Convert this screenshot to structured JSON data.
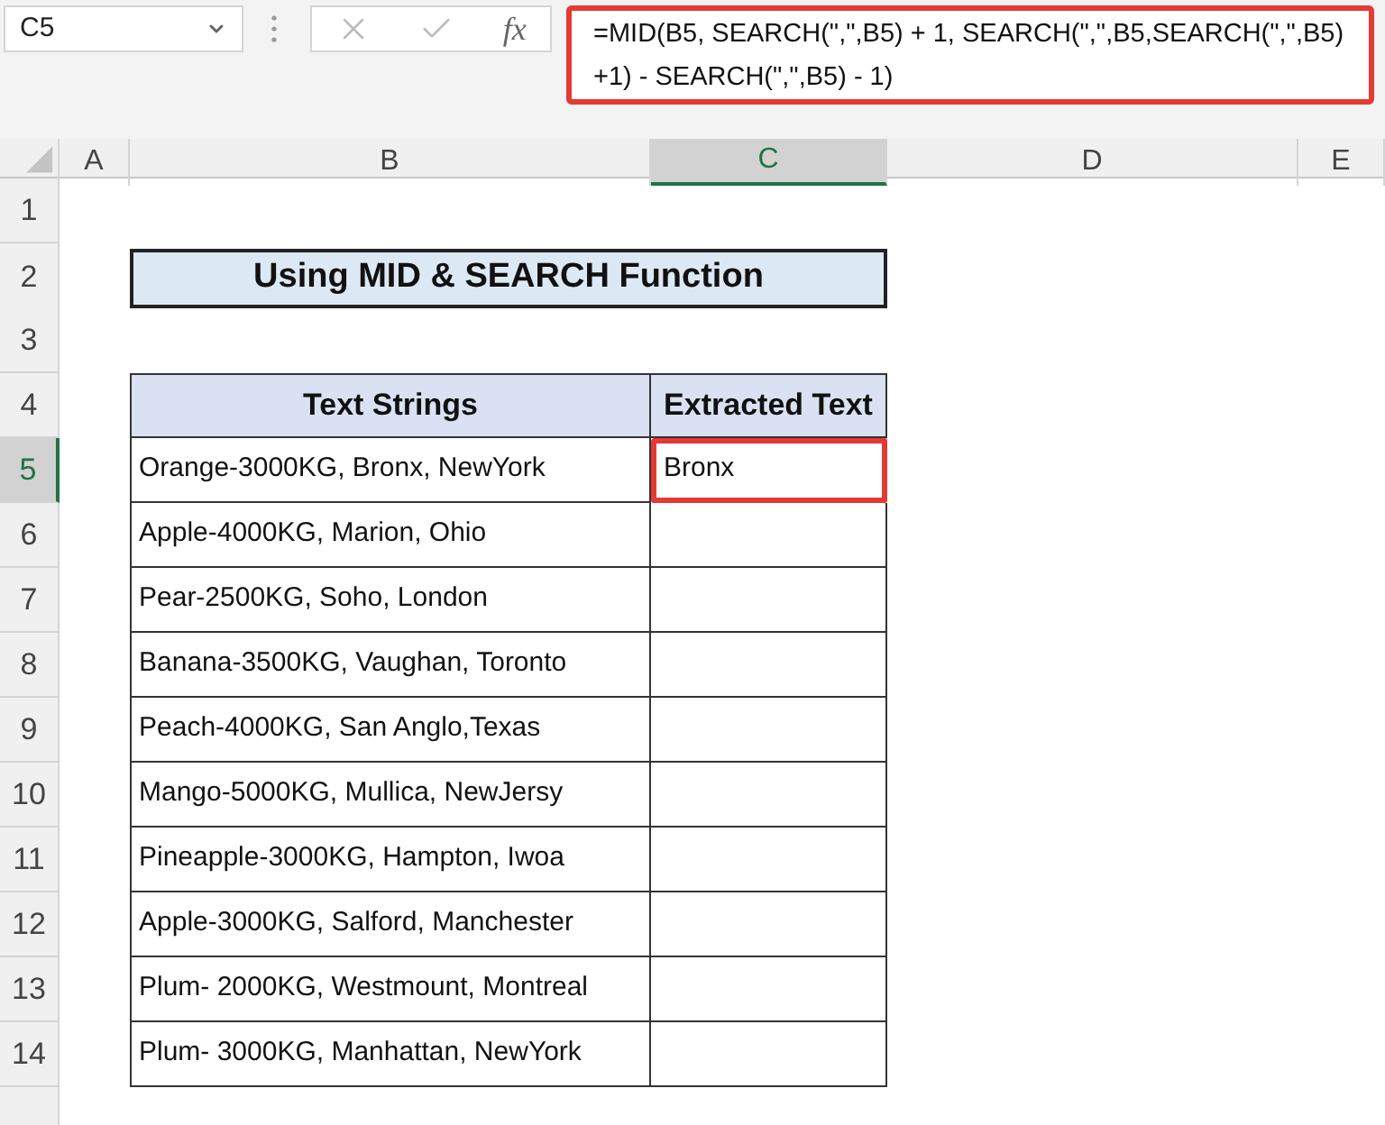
{
  "name_box": {
    "value": "C5"
  },
  "formula_bar": {
    "function_button": "fx",
    "cancel_disabled": true,
    "enter_disabled": true,
    "formula_lines": [
      "=MID(B5, SEARCH(\",\",B5) + 1, SEARCH(\",\",B5,SEARCH(\",\",B5)",
      "+1) - SEARCH(\",\",B5) - 1)"
    ],
    "highlighted": true
  },
  "columns": [
    {
      "label": "A",
      "selected": false
    },
    {
      "label": "B",
      "selected": false
    },
    {
      "label": "C",
      "selected": true
    },
    {
      "label": "D",
      "selected": false
    },
    {
      "label": "E",
      "selected": false
    }
  ],
  "row_numbers": [
    {
      "label": "1",
      "selected": false
    },
    {
      "label": "2",
      "selected": false
    },
    {
      "label": "3",
      "selected": false
    },
    {
      "label": "4",
      "selected": false
    },
    {
      "label": "5",
      "selected": true
    },
    {
      "label": "6",
      "selected": false
    },
    {
      "label": "7",
      "selected": false
    },
    {
      "label": "8",
      "selected": false
    },
    {
      "label": "9",
      "selected": false
    },
    {
      "label": "10",
      "selected": false
    },
    {
      "label": "11",
      "selected": false
    },
    {
      "label": "12",
      "selected": false
    },
    {
      "label": "13",
      "selected": false
    },
    {
      "label": "14",
      "selected": false
    }
  ],
  "sheet": {
    "title": "Using MID & SEARCH Function",
    "headers": [
      "Text Strings",
      "Extracted Text"
    ],
    "rows": [
      {
        "text": "Orange-3000KG, Bronx, NewYork",
        "extracted": "Bronx",
        "selected": true
      },
      {
        "text": "Apple-4000KG, Marion, Ohio",
        "selected": false
      },
      {
        "text": "Pear-2500KG, Soho, London",
        "selected": false
      },
      {
        "text": "Banana-3500KG, Vaughan, Toronto",
        "selected": false
      },
      {
        "text": "Peach-4000KG, San Anglo,Texas",
        "selected": false
      },
      {
        "text": "Mango-5000KG, Mullica, NewJersy",
        "selected": false
      },
      {
        "text": "Pineapple-3000KG, Hampton, Iwoa",
        "selected": false
      },
      {
        "text": "Apple-3000KG, Salford, Manchester",
        "selected": false
      },
      {
        "text": "Plum- 2000KG, Westmount, Montreal",
        "selected": false
      },
      {
        "text": "Plum- 3000KG, Manhattan, NewYork",
        "selected": false
      }
    ]
  }
}
